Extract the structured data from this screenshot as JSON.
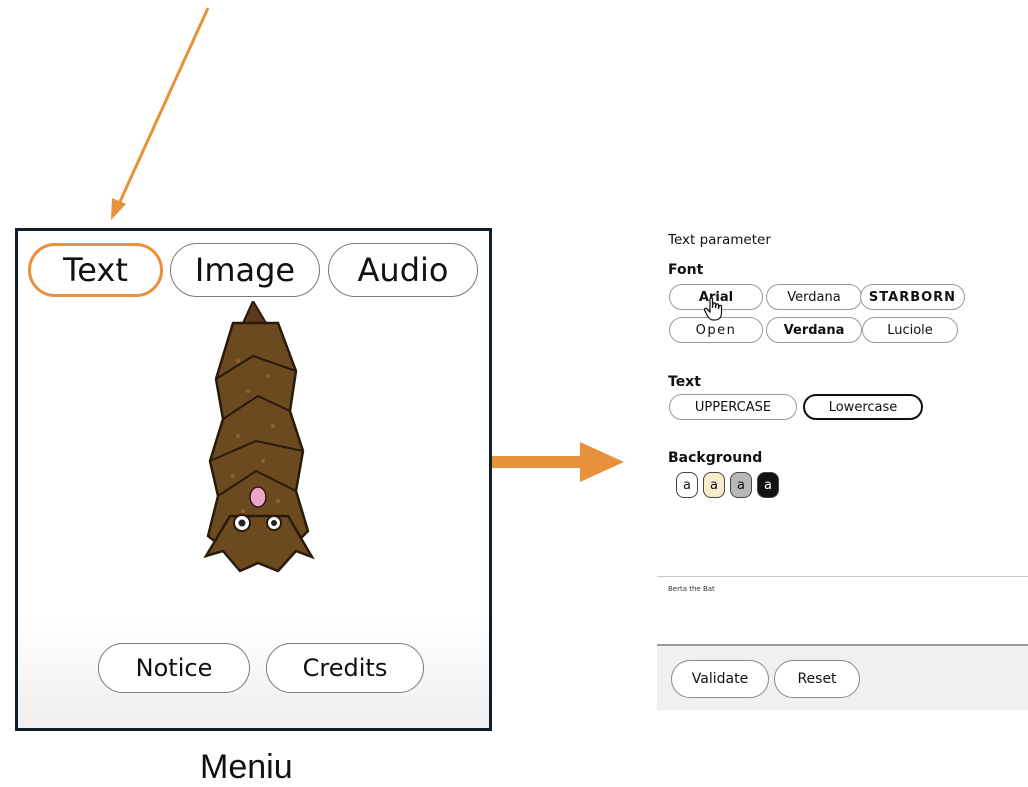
{
  "menu": {
    "tabs": [
      "Text",
      "Image",
      "Audio"
    ],
    "buttons": [
      "Notice",
      "Credits"
    ],
    "caption": "Meniu"
  },
  "settings": {
    "title": "Text parameter",
    "font": {
      "label": "Font",
      "options": [
        "Arial",
        "Verdana",
        "STARBORN",
        "Open",
        "Verdana",
        "Luciole"
      ]
    },
    "text": {
      "label": "Text",
      "options": [
        "UPPERCASE",
        "Lowercase"
      ],
      "selected": "Lowercase"
    },
    "background": {
      "label": "Background",
      "swatches": [
        {
          "glyph": "a",
          "bg": "#ffffff",
          "fg": "#111111"
        },
        {
          "glyph": "a",
          "bg": "#f8eccb",
          "fg": "#111111"
        },
        {
          "glyph": "a",
          "bg": "#b8b8b8",
          "fg": "#111111"
        },
        {
          "glyph": "a",
          "bg": "#111111",
          "fg": "#ffffff"
        }
      ]
    },
    "preview_text": "Berta the Bat",
    "footer": {
      "validate": "Validate",
      "reset": "Reset"
    }
  },
  "colors": {
    "accent": "#e8913a",
    "frame": "#0f1f2a"
  }
}
